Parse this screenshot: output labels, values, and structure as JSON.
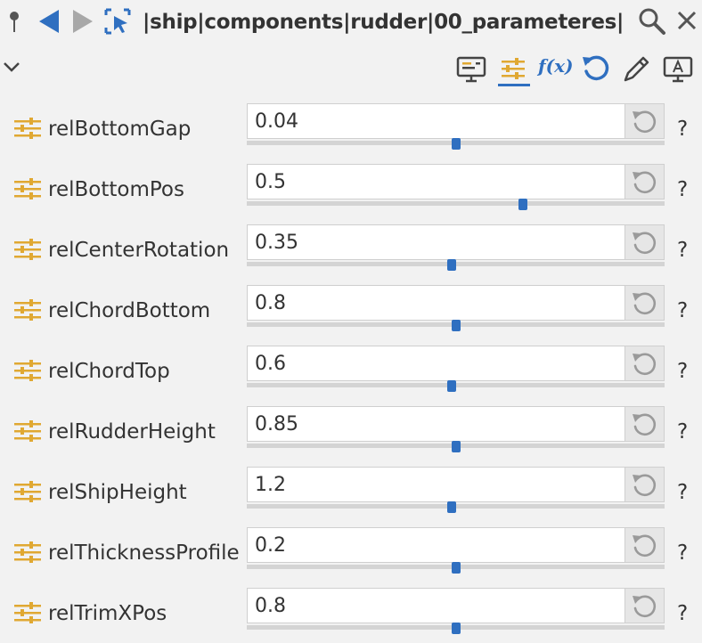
{
  "header": {
    "path": "|ship|components|rudder|00_parameteres|",
    "icons": [
      "pin-icon",
      "back-arrow-icon",
      "forward-arrow-icon",
      "select-cursor-icon",
      "search-icon",
      "close-icon"
    ]
  },
  "toolbar": {
    "fx_label": "f(x)",
    "icons": [
      "chevron-down-icon",
      "monitor-icon",
      "sliders-icon",
      "fx-icon",
      "reset-icon",
      "pencil-icon",
      "label-icon"
    ]
  },
  "colors": {
    "accent_blue": "#2f6fc0",
    "parameter_gold": "#e0a832",
    "background": "#f2f2f2"
  },
  "parameters": [
    {
      "name": "relBottomGap",
      "value": "0.04",
      "slider": 0.5
    },
    {
      "name": "relBottomPos",
      "value": "0.5",
      "slider": 0.66
    },
    {
      "name": "relCenterRotation",
      "value": "0.35",
      "slider": 0.49
    },
    {
      "name": "relChordBottom",
      "value": "0.8",
      "slider": 0.5
    },
    {
      "name": "relChordTop",
      "value": "0.6",
      "slider": 0.49
    },
    {
      "name": "relRudderHeight",
      "value": "0.85",
      "slider": 0.5
    },
    {
      "name": "relShipHeight",
      "value": "1.2",
      "slider": 0.49
    },
    {
      "name": "relThicknessProfile",
      "value": "0.2",
      "slider": 0.5
    },
    {
      "name": "relTrimXPos",
      "value": "0.8",
      "slider": 0.5
    }
  ],
  "help_label": "?"
}
